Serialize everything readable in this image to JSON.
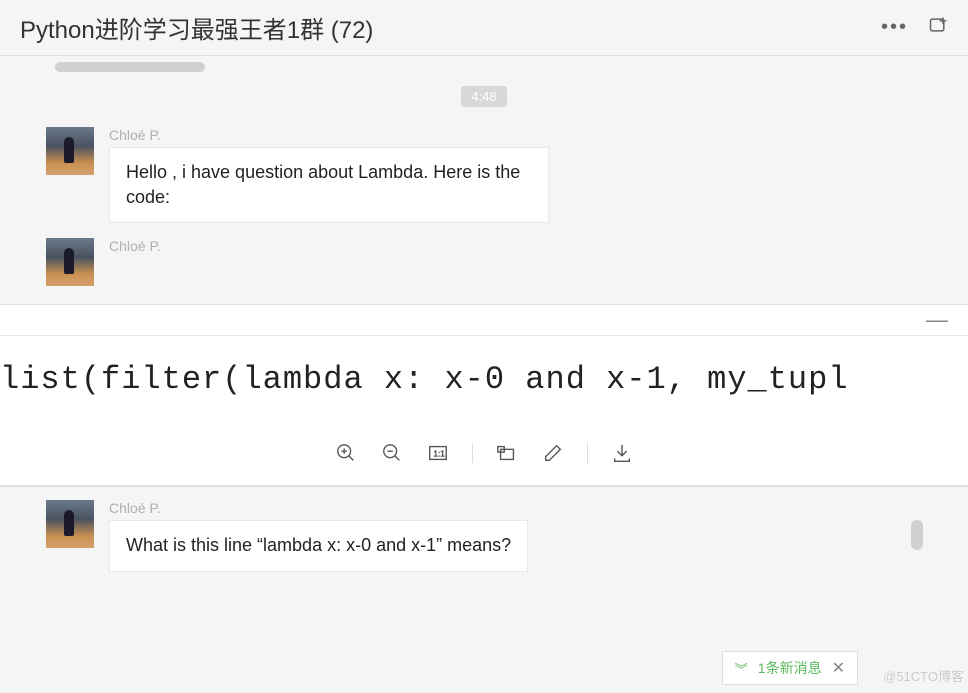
{
  "header": {
    "title": "Python进阶学习最强王者1群 (72)"
  },
  "timestamp": "4:48",
  "messages": [
    {
      "sender": "Chloé P.",
      "text": "Hello , i have question about Lambda. Here is the code:"
    },
    {
      "sender": "Chloé P.",
      "text": ""
    },
    {
      "sender": "Chloé P.",
      "text": "What is this line  “lambda x: x-0 and x-1” means?"
    }
  ],
  "image_viewer": {
    "code": "list(filter(lambda x: x-0 and x-1, my_tupl"
  },
  "notification": {
    "text": "1条新消息"
  },
  "watermark": "@51CTO博客"
}
